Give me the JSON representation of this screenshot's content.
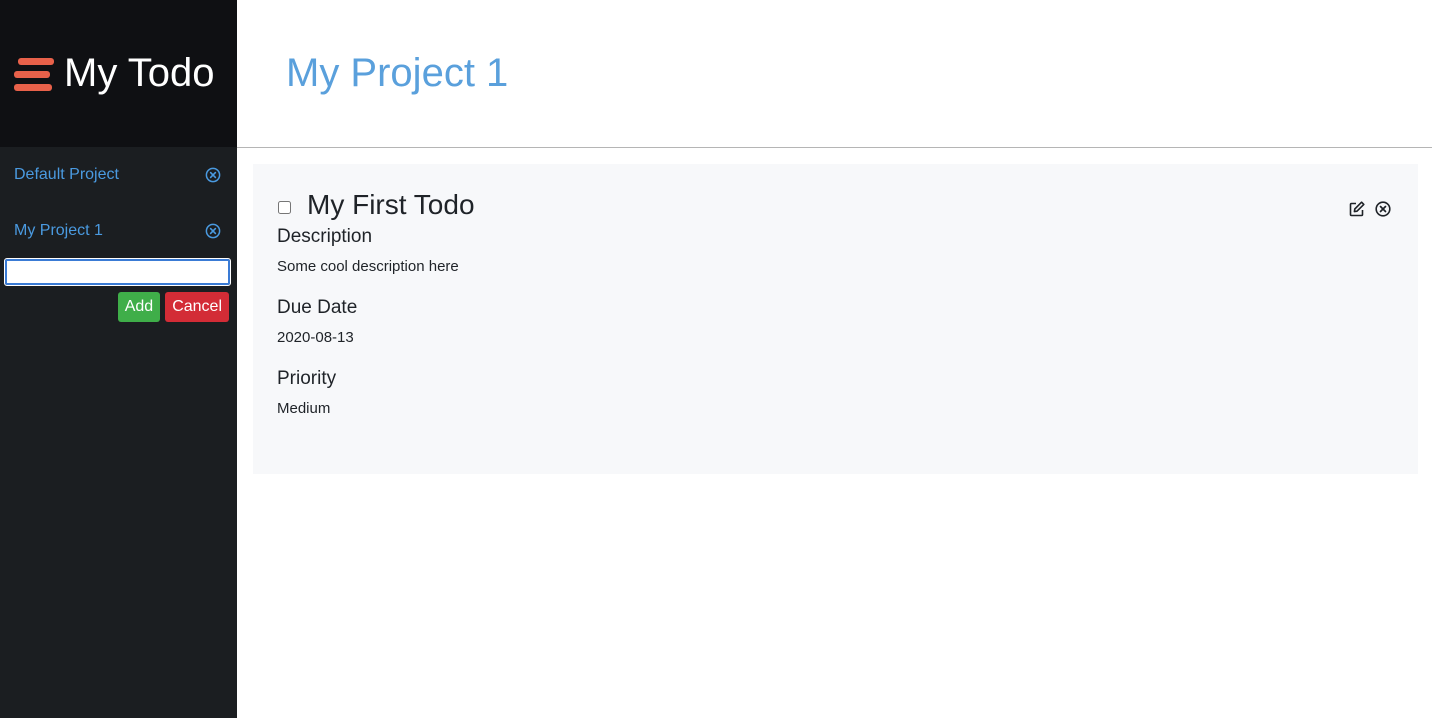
{
  "app": {
    "title": "My Todo",
    "brand_icon": "hamburger-stack-icon",
    "accent_color": "#e8614a"
  },
  "sidebar": {
    "projects": [
      {
        "label": "Default Project",
        "remove_icon": "circle-x-icon"
      },
      {
        "label": "My Project 1",
        "remove_icon": "circle-x-icon"
      }
    ],
    "new_project": {
      "value": "",
      "placeholder": ""
    },
    "add_label": "Add",
    "cancel_label": "Cancel"
  },
  "main": {
    "project_title": "My Project 1",
    "todos": [
      {
        "title": "My First Todo",
        "completed": false,
        "edit_icon": "edit-icon",
        "delete_icon": "circle-x-icon",
        "fields": {
          "description": {
            "label": "Description",
            "value": "Some cool description here"
          },
          "due_date": {
            "label": "Due Date",
            "value": "2020-08-13"
          },
          "priority": {
            "label": "Priority",
            "value": "Medium"
          }
        }
      }
    ]
  },
  "colors": {
    "sidebar_bg": "#1b1e21",
    "brand_bg": "#0f1013",
    "link": "#4a9ae0",
    "title": "#5aa0dc",
    "add_button": "#3fae49",
    "cancel_button": "#d32c36",
    "card_bg": "#f7f8fa"
  }
}
